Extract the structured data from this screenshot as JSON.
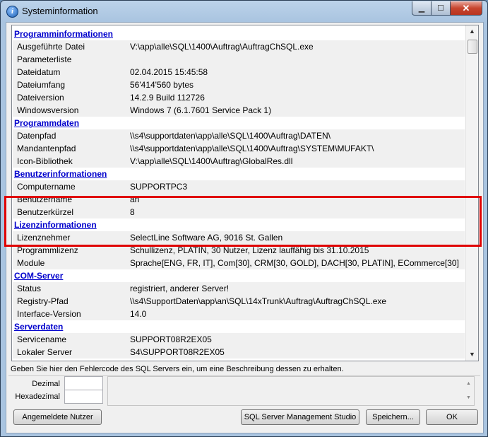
{
  "window": {
    "title": "Systeminformation",
    "icon": "info-icon"
  },
  "controls": {
    "minimize": "▁",
    "maximize": "☐",
    "close": "✕"
  },
  "sections": [
    {
      "title": "Programminformationen",
      "rows": [
        {
          "key": "Ausgeführte Datei",
          "value": "V:\\app\\alle\\SQL\\1400\\Auftrag\\AuftragChSQL.exe"
        },
        {
          "key": "Parameterliste",
          "value": ""
        },
        {
          "key": "Dateidatum",
          "value": "02.04.2015 15:45:58"
        },
        {
          "key": "Dateiumfang",
          "value": "56'414'560 bytes"
        },
        {
          "key": "Dateiversion",
          "value": "14.2.9 Build 112726"
        },
        {
          "key": "Windowsversion",
          "value": "Windows 7 (6.1.7601 Service Pack 1)"
        }
      ]
    },
    {
      "title": "Programmdaten",
      "rows": [
        {
          "key": "Datenpfad",
          "value": "\\\\s4\\supportdaten\\app\\alle\\SQL\\1400\\Auftrag\\DATEN\\"
        },
        {
          "key": "Mandantenpfad",
          "value": "\\\\s4\\supportdaten\\app\\alle\\SQL\\1400\\Auftrag\\SYSTEM\\MUFAKT\\"
        },
        {
          "key": "Icon-Bibliothek",
          "value": "V:\\app\\alle\\SQL\\1400\\Auftrag\\GlobalRes.dll"
        }
      ]
    },
    {
      "title": "Benutzerinformationen",
      "rows": [
        {
          "key": "Computername",
          "value": "SUPPORTPC3"
        },
        {
          "key": "Benutzername",
          "value": "an"
        },
        {
          "key": "Benutzerkürzel",
          "value": " 8"
        }
      ]
    },
    {
      "title": "Lizenzinformationen",
      "rows": [
        {
          "key": "Lizenznehmer",
          "value": "SelectLine Software AG, 9016 St. Gallen"
        },
        {
          "key": "Programmlizenz",
          "value": "Schullizenz, PLATIN, 30 Nutzer, Lizenz lauffähig bis 31.10.2015"
        },
        {
          "key": "Module",
          "value": "Sprache[ENG, FR, IT], Com[30], CRM[30, GOLD], DACH[30, PLATIN], ECommerce[30]"
        }
      ]
    },
    {
      "title": "COM-Server",
      "rows": [
        {
          "key": "Status",
          "value": "registriert, anderer Server!"
        },
        {
          "key": "Registry-Pfad",
          "value": "\\\\s4\\SupportDaten\\app\\an\\SQL\\14xTrunk\\Auftrag\\AuftragChSQL.exe"
        },
        {
          "key": "Interface-Version",
          "value": "14.0"
        }
      ]
    },
    {
      "title": "Serverdaten",
      "rows": [
        {
          "key": "Servicename",
          "value": "SUPPORT08R2EX05"
        },
        {
          "key": "Lokaler Server",
          "value": "S4\\SUPPORT08R2EX05"
        }
      ]
    }
  ],
  "scroll": {
    "up": "▲",
    "down": "▼",
    "up_small": "▲",
    "down_small": "▼"
  },
  "error_lookup": {
    "hint": "Geben Sie hier den Fehlercode des SQL Servers ein, um eine Beschreibung dessen zu erhalten.",
    "decimal_label": "Dezimal",
    "decimal_value": "",
    "hex_label": "Hexadezimal",
    "hex_value": "",
    "description": ""
  },
  "buttons": {
    "users": "Angemeldete Nutzer",
    "ssms": "SQL Server Management Studio",
    "save": "Speichern...",
    "ok": "OK"
  }
}
